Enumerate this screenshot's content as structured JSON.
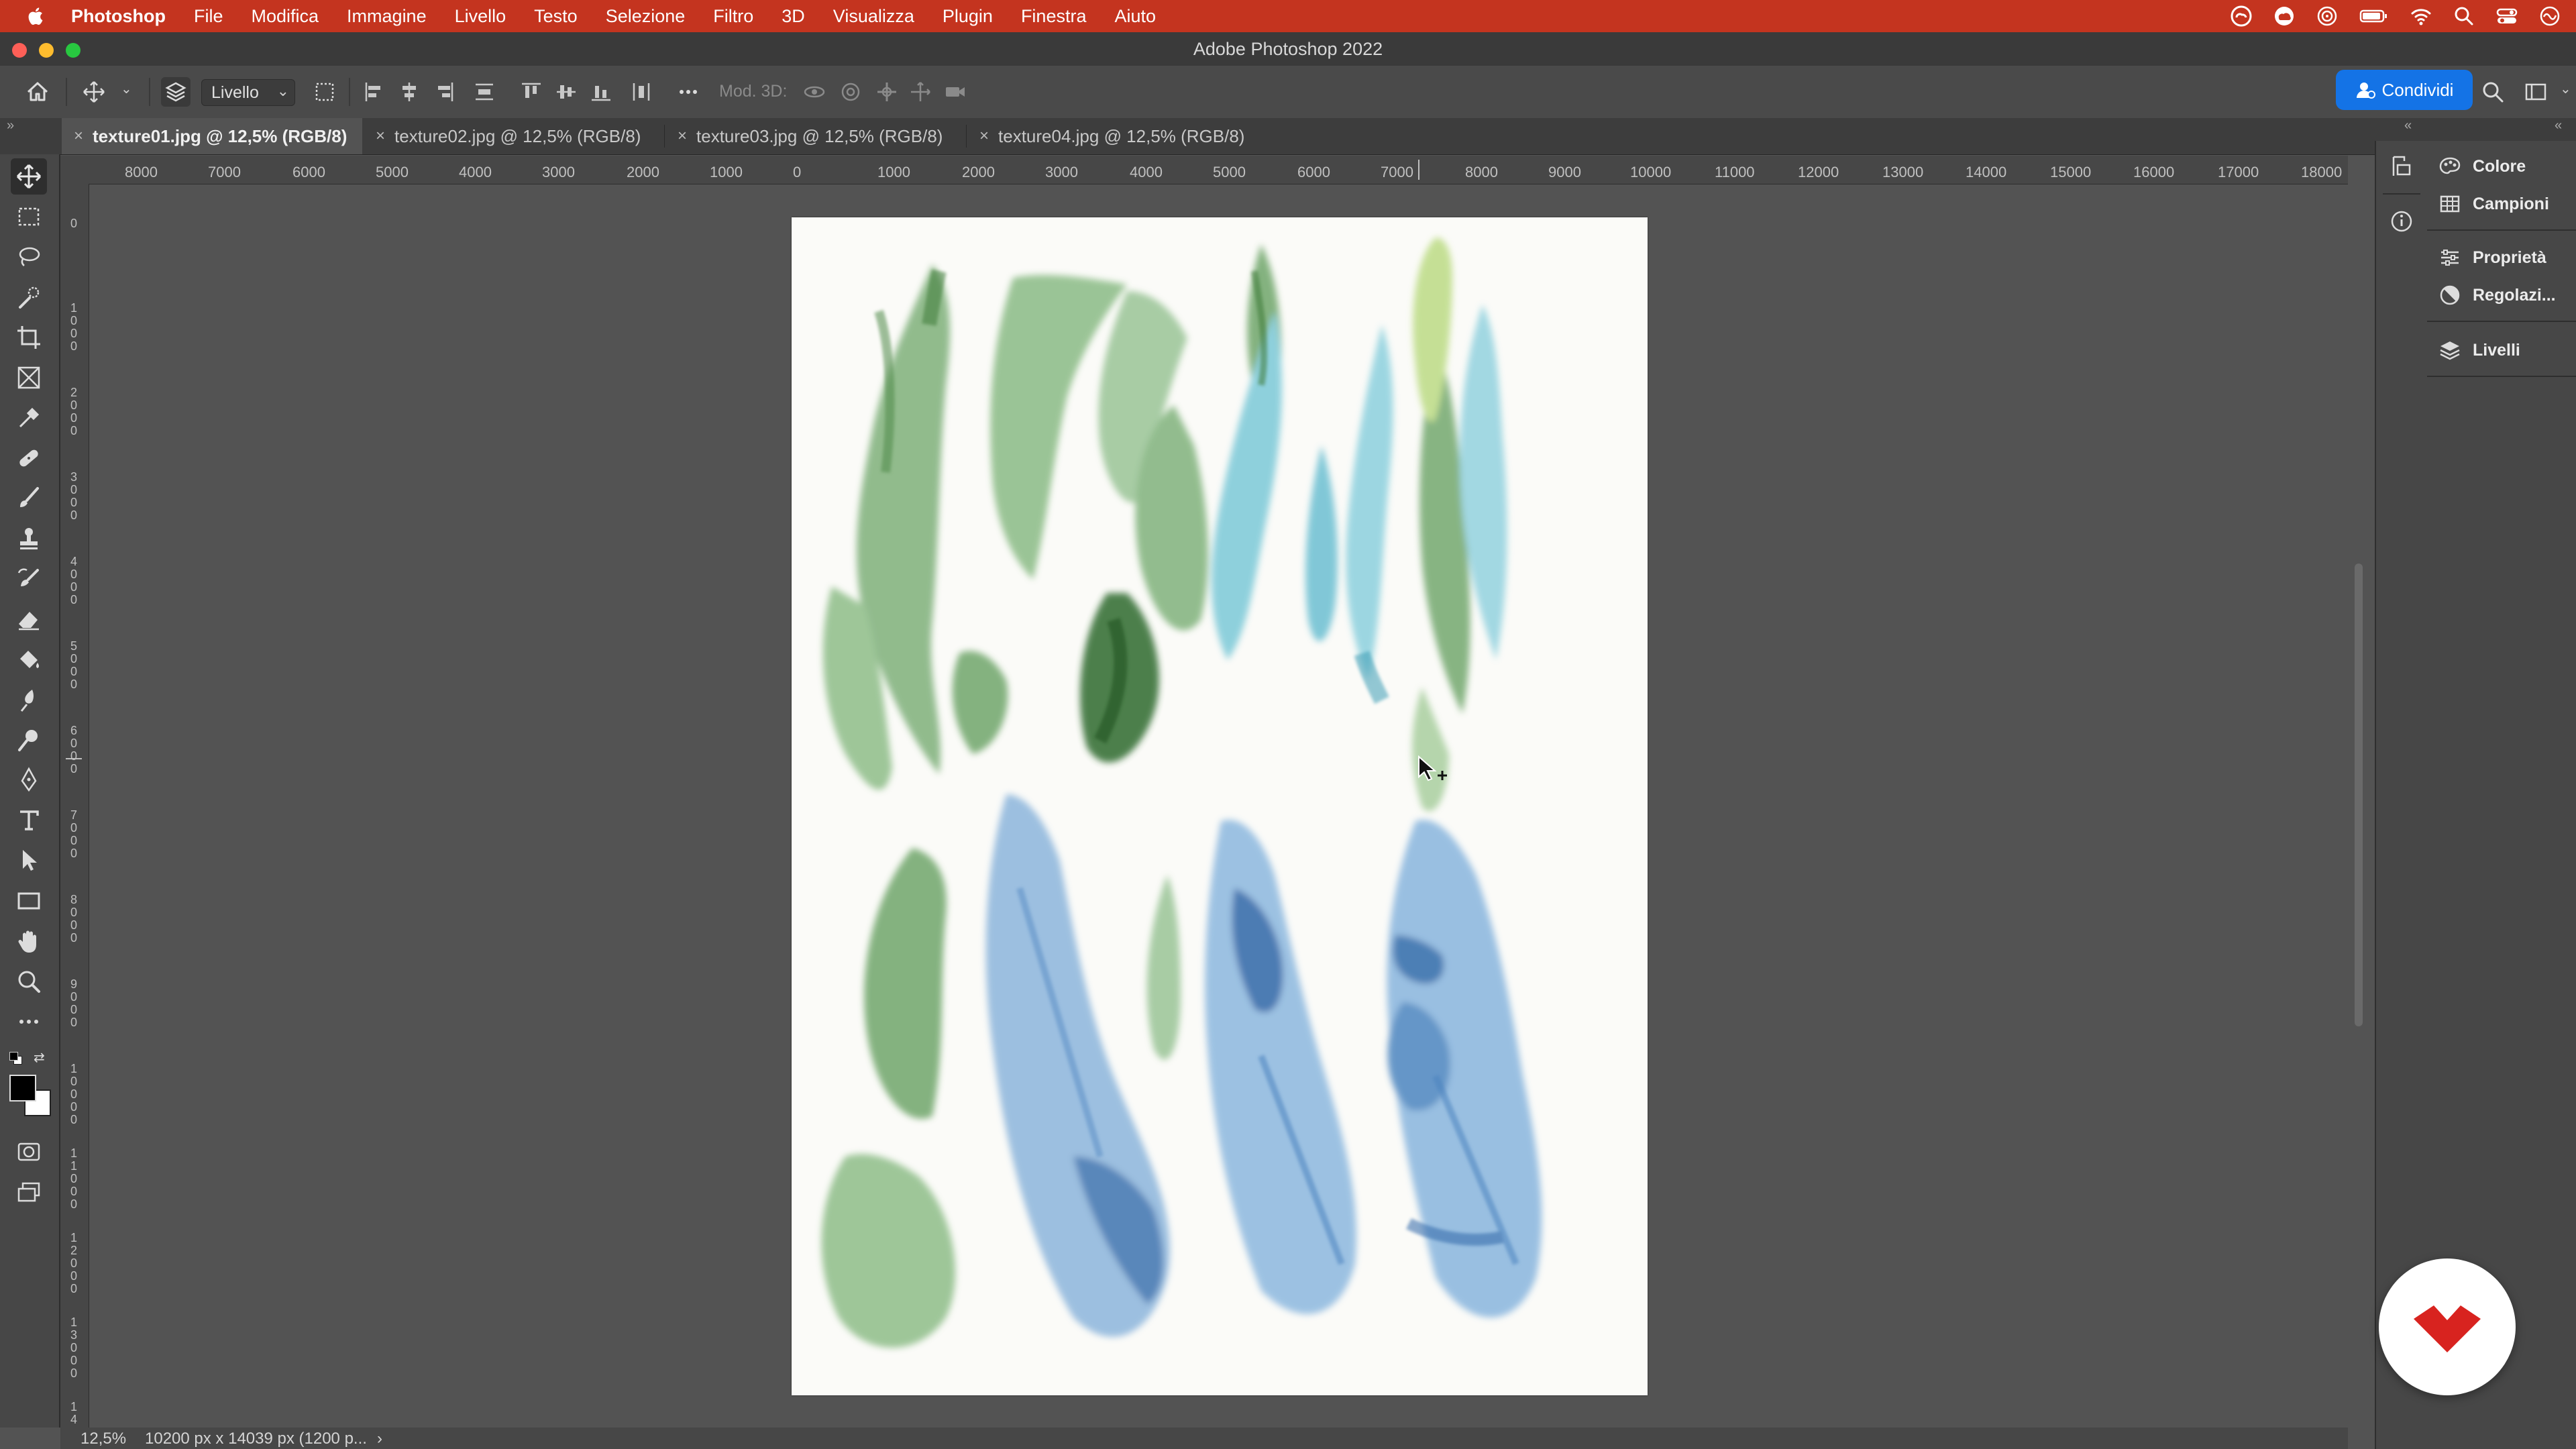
{
  "menubar": {
    "app_name": "Photoshop",
    "items": [
      "File",
      "Modifica",
      "Immagine",
      "Livello",
      "Testo",
      "Selezione",
      "Filtro",
      "3D",
      "Visualizza",
      "Plugin",
      "Finestra",
      "Aiuto"
    ]
  },
  "window": {
    "title": "Adobe Photoshop 2022"
  },
  "options": {
    "layer_select": "Livello",
    "mod3d_label": "Mod. 3D:",
    "share_label": "Condividi"
  },
  "tabs": [
    {
      "label": "texture01.jpg @ 12,5% (RGB/8)",
      "active": true
    },
    {
      "label": "texture02.jpg @ 12,5% (RGB/8)",
      "active": false
    },
    {
      "label": "texture03.jpg @ 12,5% (RGB/8)",
      "active": false
    },
    {
      "label": "texture04.jpg @ 12,5% (RGB/8)",
      "active": false
    }
  ],
  "ruler": {
    "top_labels": [
      "8000",
      "7000",
      "6000",
      "5000",
      "4000",
      "3000",
      "2000",
      "1000",
      "0",
      "1000",
      "2000",
      "3000",
      "4000",
      "5000",
      "6000",
      "7000",
      "8000",
      "9000",
      "10000",
      "11000",
      "12000",
      "13000",
      "14000",
      "15000",
      "16000",
      "17000",
      "18000"
    ],
    "left_labels": [
      "0",
      "1000",
      "2000",
      "3000",
      "4000",
      "5000",
      "6000",
      "7000",
      "8000",
      "9000",
      "10000",
      "11000",
      "12000",
      "13000",
      "14"
    ]
  },
  "status": {
    "zoom": "12,5%",
    "doc_info": "10200 px x 14039 px (1200 p...",
    "arrow": "›"
  },
  "panels": {
    "group1": [
      "Colore",
      "Campioni"
    ],
    "group2": [
      "Proprietà",
      "Regolazi..."
    ],
    "group3": [
      "Livelli"
    ]
  },
  "colors": {
    "menubar": "#c4341f",
    "accent_blue": "#1473e6",
    "chrome_dark": "#3d3d3d",
    "canvas_bg": "#535353"
  }
}
